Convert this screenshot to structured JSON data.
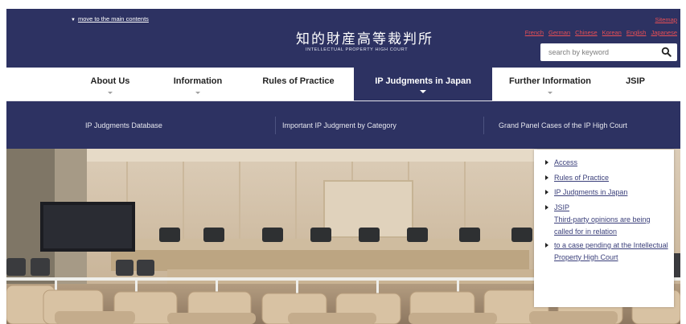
{
  "header": {
    "skip_link": "move to the main contents",
    "logo_jp": "知的財産高等裁判所",
    "logo_en": "INTELLECTUAL PROPERTY HIGH COURT",
    "sitemap": "Sitemap",
    "languages": [
      "French",
      "German",
      "Chinese",
      "Korean",
      "English",
      "Japanese"
    ],
    "search": {
      "placeholder": "search by keyword",
      "icon": "search-icon"
    }
  },
  "nav": {
    "items": [
      {
        "label": "About Us"
      },
      {
        "label": "Information"
      },
      {
        "label": "Rules of Practice"
      },
      {
        "label": "IP Judgments in Japan"
      },
      {
        "label": "Further Information"
      },
      {
        "label": "JSIP"
      }
    ],
    "active": "IP Judgments in Japan"
  },
  "subnav": {
    "items": [
      {
        "label": "IP Judgments Database"
      },
      {
        "label": "Important IP Judgment by Category"
      },
      {
        "label": "Grand Panel Cases of the IP High Court"
      }
    ]
  },
  "quick_links": {
    "items": [
      {
        "label": "Access"
      },
      {
        "label": "Rules of Practice"
      },
      {
        "label": "IP Judgments in Japan"
      },
      {
        "label": "JSIP"
      }
    ],
    "notice_line1": "Third-party opinions are being called for in relation",
    "notice_line2": "to a case pending at the Intellectual Property High Court"
  },
  "colors": {
    "header_bg": "#2d3262",
    "link_red": "#e94f55",
    "link_blue": "#3a3f7a",
    "nav_text": "#232323"
  }
}
